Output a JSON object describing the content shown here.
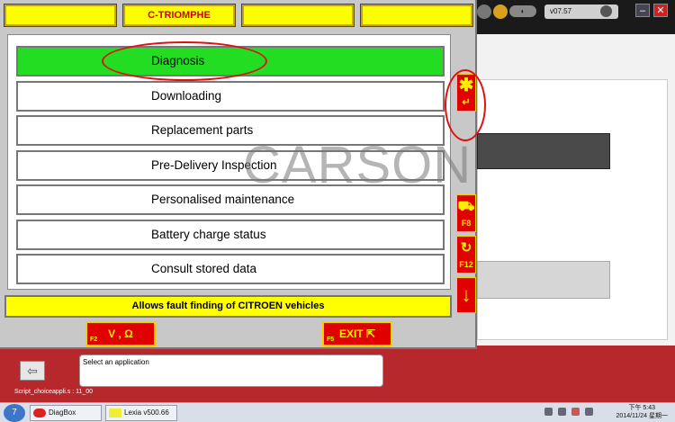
{
  "header": {
    "title": "C-TRIOMPHE",
    "version": "v07.57"
  },
  "menu": {
    "items": [
      {
        "label": "Diagnosis",
        "active": true
      },
      {
        "label": "Downloading",
        "active": false
      },
      {
        "label": "Replacement parts",
        "active": false
      },
      {
        "label": "Pre-Delivery Inspection",
        "active": false
      },
      {
        "label": "Personalised maintenance",
        "active": false
      },
      {
        "label": "Battery charge status",
        "active": false
      },
      {
        "label": "Consult stored data",
        "active": false
      }
    ]
  },
  "status_text": "Allows fault finding of CITROEN vehicles",
  "side_buttons": {
    "f8": "F8",
    "f12": "F12"
  },
  "function_buttons": {
    "f2_key": "F2",
    "f2_label": "V , Ω",
    "f5_key": "F5",
    "f5_label": "EXIT"
  },
  "message_box": "Select an application",
  "script_label": "Script_choiceappli.s : 11_00",
  "watermark": "CARSON",
  "taskbar": {
    "start_label": "7",
    "tasks": [
      "DiagBox",
      "Lexia v500.66"
    ],
    "time": "下午 5:43",
    "date": "2014/11/24 星期一"
  },
  "colors": {
    "active_item": "#22dd22",
    "header_yellow": "#ffff00",
    "button_red": "#e00000",
    "frame_red": "#b7282c"
  }
}
